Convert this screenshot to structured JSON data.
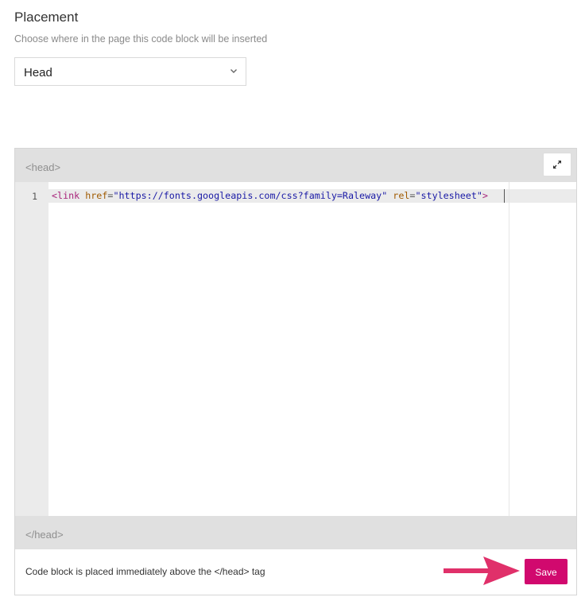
{
  "placement": {
    "title": "Placement",
    "subtitle": "Choose where in the page this code block will be inserted",
    "select": {
      "value": "Head"
    }
  },
  "editor": {
    "open_tag_label": "<head>",
    "close_tag_label": "</head>",
    "expand_icon": "expand-icon",
    "line_numbers": [
      "1"
    ],
    "code_lines": [
      {
        "tag_open": "<link",
        "attr1_name": "href",
        "eq1": "=",
        "attr1_value": "\"https://fonts.googleapis.com/css?family=Raleway\"",
        "attr2_name": "rel",
        "eq2": "=",
        "attr2_value": "\"stylesheet\"",
        "tag_close": ">"
      }
    ]
  },
  "footer": {
    "note": "Code block is placed immediately above the </head> tag",
    "save_label": "Save"
  },
  "colors": {
    "accent": "#d1096e",
    "arrow": "#e0306a",
    "header_bar": "#e0e0e0"
  }
}
